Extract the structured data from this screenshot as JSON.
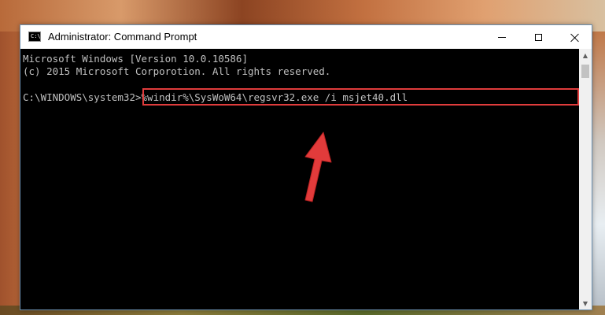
{
  "window": {
    "title": "Administrator: Command Prompt",
    "icon": "cmd-icon",
    "icon_text": "C:\\"
  },
  "console": {
    "line1": "Microsoft Windows [Version 10.0.10586]",
    "line2": "(c) 2015 Microsoft Corporotion. All rights reserved.",
    "prompt": "C:\\WINDOWS\\system32>",
    "command": "%windir%\\SysWoW64\\regsvr32.exe /i msjet40.dll"
  },
  "colors": {
    "highlight": "#e03c3c",
    "console_bg": "#000000",
    "console_text": "#c0c0c0"
  }
}
